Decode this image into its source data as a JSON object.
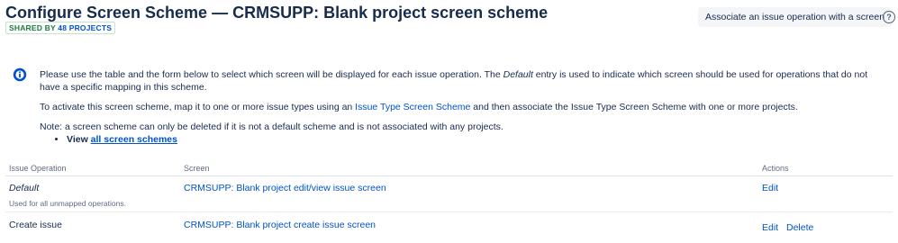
{
  "header": {
    "title": "Configure Screen Scheme — CRMSUPP: Blank project screen scheme",
    "badge_prefix": "SHARED BY",
    "badge_count": "48 PROJECTS",
    "associate_button": "Associate an issue operation with a screen",
    "help_icon": "question-circle-icon",
    "help_glyph": "?"
  },
  "info": {
    "icon": "info-circle-icon",
    "p1_before": "Please use the table and the form below to select which screen will be displayed for each issue operation. The ",
    "p1_em": "Default",
    "p1_after": " entry is used to indicate which screen should be used for operations that do not have a specific mapping in this scheme.",
    "p2_before": "To activate this screen scheme, map it to one or more issue types using an ",
    "p2_link": "Issue Type Screen Scheme",
    "p2_after": " and then associate the Issue Type Screen Scheme with one or more projects.",
    "p3": "Note: a screen scheme can only be deleted if it is not a default scheme and is not associated with any projects.",
    "view_label": "View ",
    "view_link": "all screen schemes"
  },
  "table": {
    "columns": [
      "Issue Operation",
      "Screen",
      "Actions"
    ],
    "rows": [
      {
        "operation": "Default",
        "description": "Used for all unmapped operations.",
        "screen": "CRMSUPP: Blank project edit/view issue screen",
        "actions": [
          "Edit"
        ]
      },
      {
        "operation": "Create issue",
        "description": "",
        "screen": "CRMSUPP: Blank project create issue screen",
        "actions": [
          "Edit",
          "Delete"
        ]
      }
    ]
  },
  "colors": {
    "link": "#0052cc",
    "text": "#172b4d",
    "badge_green": "#1f7a3f",
    "info_blue": "#0052cc"
  }
}
